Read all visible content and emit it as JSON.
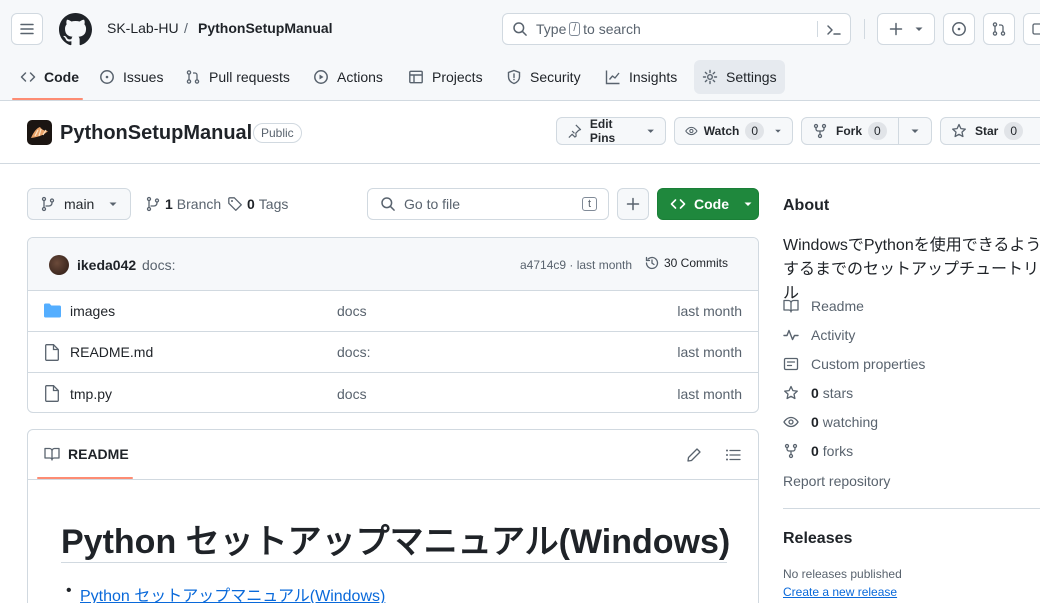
{
  "header": {
    "owner": "SK-Lab-HU",
    "separator": "/",
    "repo": "PythonSetupManual",
    "search": {
      "prefix": "Type",
      "key": "/",
      "suffix": "to search"
    }
  },
  "tabs": [
    {
      "label": "Code"
    },
    {
      "label": "Issues"
    },
    {
      "label": "Pull requests"
    },
    {
      "label": "Actions"
    },
    {
      "label": "Projects"
    },
    {
      "label": "Security"
    },
    {
      "label": "Insights"
    },
    {
      "label": "Settings"
    }
  ],
  "repo": {
    "name": "PythonSetupManual",
    "visibility": "Public",
    "edit_pins": "Edit Pins",
    "watch": {
      "label": "Watch",
      "count": "0"
    },
    "fork": {
      "label": "Fork",
      "count": "0"
    },
    "star": {
      "label": "Star",
      "count": "0"
    }
  },
  "toolbar": {
    "branch": "main",
    "branches_count": "1",
    "branches_label": "Branch",
    "tags_count": "0",
    "tags_label": "Tags",
    "go_to_file": "Go to file",
    "go_to_file_key": "t",
    "code_button": "Code"
  },
  "commit": {
    "author": "ikeda042",
    "message": "docs:",
    "hash_time": "a4714c9 · last month",
    "commits": "30 Commits"
  },
  "files": [
    {
      "type": "folder",
      "name": "images",
      "message": "docs",
      "date": "last month"
    },
    {
      "type": "file",
      "name": "README.md",
      "message": "docs:",
      "date": "last month"
    },
    {
      "type": "file",
      "name": "tmp.py",
      "message": "docs",
      "date": "last month"
    }
  ],
  "readme": {
    "tab": "README",
    "h1": "Python セットアップマニュアル(Windows)",
    "toc_item": "Python セットアップマニュアル(Windows)"
  },
  "about": {
    "title": "About",
    "description": "WindowsでPythonを使用できるようにするまでのセットアップチュートリアル",
    "readme": "Readme",
    "activity": "Activity",
    "custom_properties": "Custom properties",
    "stars_count": "0",
    "stars_label": "stars",
    "watching_count": "0",
    "watching_label": "watching",
    "forks_count": "0",
    "forks_label": "forks",
    "report": "Report repository"
  },
  "releases": {
    "title": "Releases",
    "none": "No releases published",
    "create": "Create a new release"
  },
  "colors": {
    "accent_underline": "#fd8c73",
    "code_button": "#1f883d",
    "link": "#0969da",
    "folder": "#54aeff"
  }
}
